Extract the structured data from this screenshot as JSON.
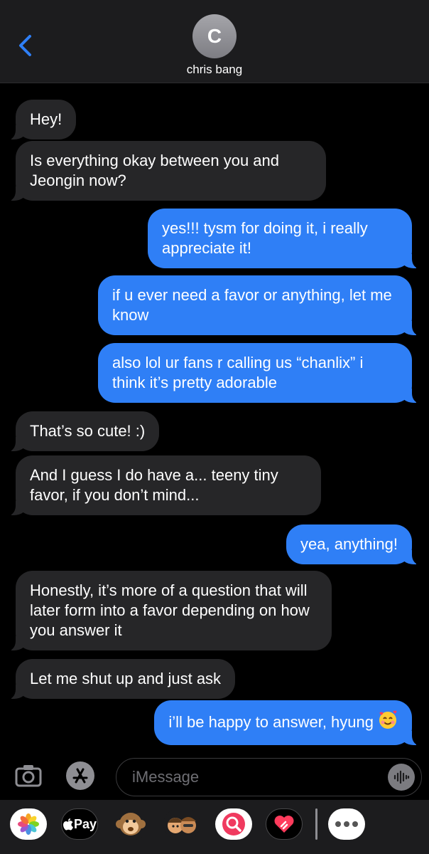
{
  "header": {
    "back_icon": "chevron-left-icon",
    "avatar_initial": "C",
    "contact_name": "chris bang"
  },
  "messages": [
    {
      "from": "them",
      "text": "Hey!"
    },
    {
      "from": "them",
      "text": "Is everything okay between you and Jeongin now?"
    },
    {
      "from": "me",
      "text": "yes!!! tysm for doing it, i really appreciate it!"
    },
    {
      "from": "me",
      "text": "if u ever need a favor or anything, let me know"
    },
    {
      "from": "me",
      "text": "also lol ur fans r calling us “chanlix” i think it’s pretty adorable"
    },
    {
      "from": "them",
      "text": "That’s so cute! :)"
    },
    {
      "from": "them",
      "text": "And I guess I do have a... teeny tiny favor, if you don’t mind..."
    },
    {
      "from": "me",
      "text": "yea, anything!"
    },
    {
      "from": "them",
      "text": "Honestly, it’s more of a question that will later form into a favor depending on how you answer it"
    },
    {
      "from": "them",
      "text": "Let me shut up and just ask"
    },
    {
      "from": "me",
      "text": "i’ll be happy to answer, hyung",
      "emoji": "smiling-face-with-hearts"
    }
  ],
  "composer": {
    "camera_icon": "camera-icon",
    "apps_icon": "app-store-icon",
    "placeholder": "iMessage",
    "audio_icon": "waveform-icon"
  },
  "app_drawer": {
    "items": [
      {
        "name": "photos-icon"
      },
      {
        "name": "apple-pay-icon",
        "label": "Pay"
      },
      {
        "name": "animoji-monkey-icon"
      },
      {
        "name": "memoji-stickers-icon"
      },
      {
        "name": "image-search-icon"
      },
      {
        "name": "digital-touch-icon"
      },
      {
        "name": "more-apps-icon"
      }
    ]
  },
  "colors": {
    "outgoing_bubble": "#2f7ff6",
    "incoming_bubble": "#262628",
    "accent": "#2f7ff6"
  }
}
